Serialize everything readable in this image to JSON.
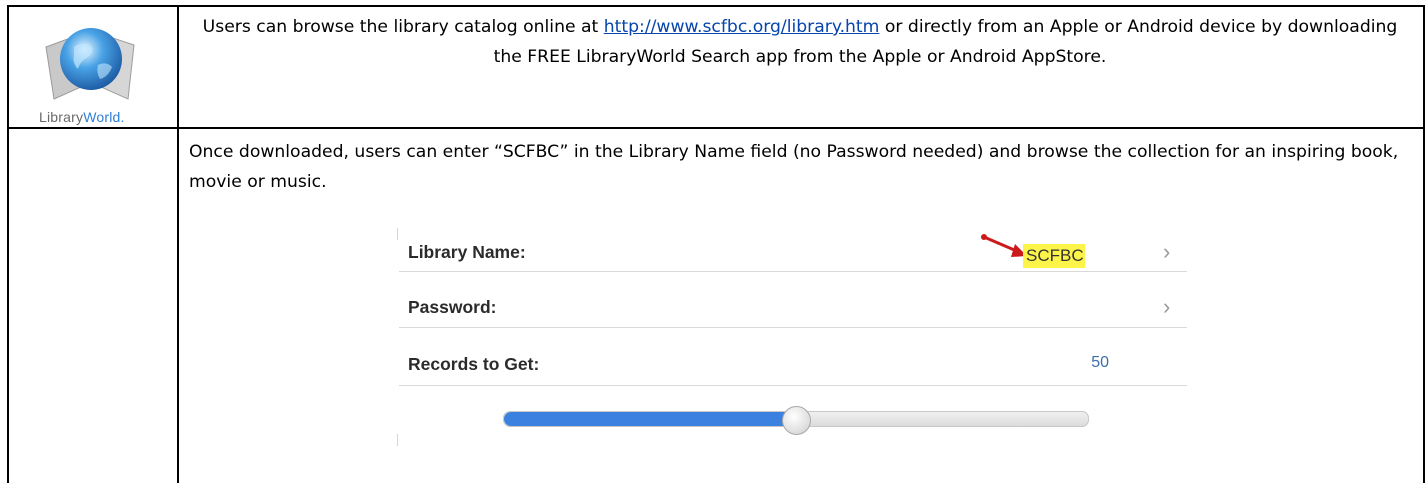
{
  "logo": {
    "text_part1": "Library",
    "text_part2": "World",
    "text_mark": "."
  },
  "intro": {
    "text_before": "Users can browse the library catalog online at ",
    "link_text": "http://www.scfbc.org/library.htm",
    "text_after": " or directly from an Apple or Android device by downloading  the FREE LibraryWorld Search app from the Apple or Android  AppStore."
  },
  "instructions": "Once downloaded, users can enter “SCFBC” in the Library Name field (no Password needed) and browse the collection for an inspiring book, movie or music.",
  "app_screenshot": {
    "library_name_label": "Library Name:",
    "library_name_value": "SCFBC",
    "password_label": "Password:",
    "records_label": "Records to Get:",
    "records_value": "50",
    "chevron": "›",
    "slider_fraction": 0.5,
    "slider_fill_color": "#3b82e0",
    "highlight_color": "#fdf44a",
    "arrow_color": "#cc1a1a"
  }
}
